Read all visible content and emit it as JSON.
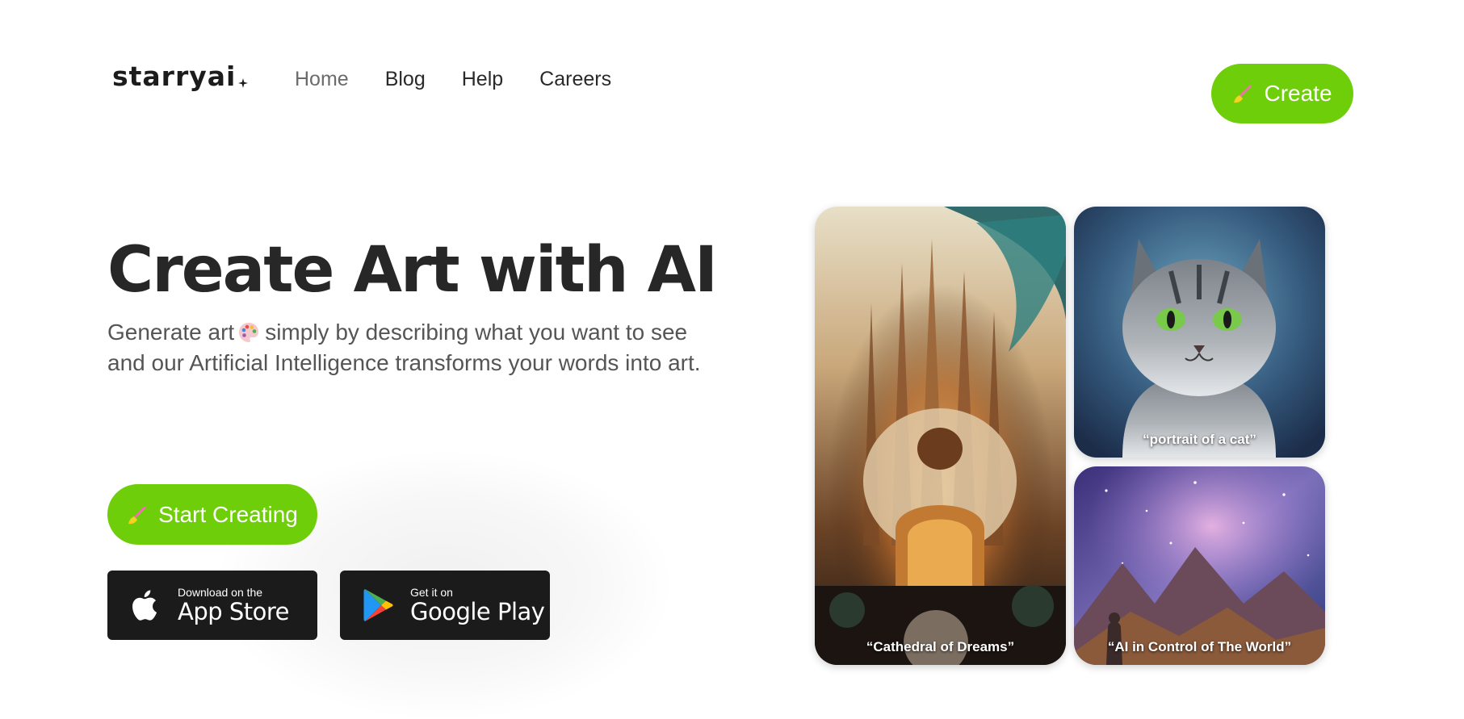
{
  "header": {
    "logo_text": "starryai",
    "nav": [
      {
        "label": "Home",
        "active": true
      },
      {
        "label": "Blog"
      },
      {
        "label": "Help"
      },
      {
        "label": "Careers"
      }
    ],
    "create_button": {
      "label": "Create",
      "icon": "brush-icon"
    }
  },
  "hero": {
    "title": "Create Art with AI",
    "subtitle_part1": "Generate art",
    "subtitle_part2": "simply by describing what you want to see",
    "subtitle_line2": "and our Artificial Intelligence transforms your words into art.",
    "start_button": {
      "label": "Start Creating",
      "icon": "brush-icon"
    }
  },
  "stores": {
    "apple": {
      "small": "Download on the",
      "big": "App Store",
      "icon": "apple-icon"
    },
    "google": {
      "small": "Get it on",
      "big": "Google Play",
      "icon": "google-play-icon"
    }
  },
  "gallery": [
    {
      "caption": "“Cathedral of Dreams”"
    },
    {
      "caption": "“portrait of a cat”"
    },
    {
      "caption": "“AI in Control of The World”"
    }
  ],
  "colors": {
    "accent": "#6fce0a",
    "text": "#272727",
    "subtle_text": "#555555",
    "store_bg": "#1b1b1b",
    "background": "#ffffff"
  }
}
